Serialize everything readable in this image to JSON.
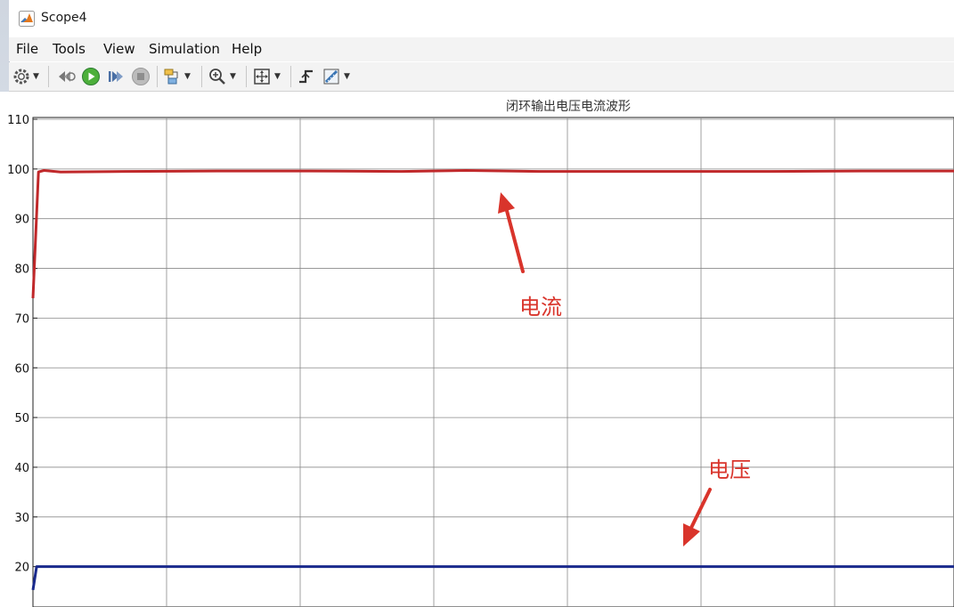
{
  "window": {
    "title": "Scope4",
    "icon": "matlab-logo-icon"
  },
  "menu": [
    "File",
    "Tools",
    "View",
    "Simulation",
    "Help"
  ],
  "toolbar": [
    {
      "name": "settings-button",
      "icon": "gear-icon",
      "dropdown": true
    },
    {
      "name": "step-back-button",
      "icon": "step-back-icon",
      "dropdown": false
    },
    {
      "name": "run-button",
      "icon": "play-icon",
      "dropdown": false
    },
    {
      "name": "step-forward-button",
      "icon": "step-forward-icon",
      "dropdown": false
    },
    {
      "name": "stop-button",
      "icon": "stop-icon",
      "dropdown": false
    },
    {
      "name": "highlight-block-button",
      "icon": "highlight-icon",
      "dropdown": true
    },
    {
      "name": "zoom-button",
      "icon": "zoom-in-icon",
      "dropdown": true
    },
    {
      "name": "autoscale-button",
      "icon": "autoscale-icon",
      "dropdown": true
    },
    {
      "name": "triggers-button",
      "icon": "trigger-icon",
      "dropdown": false
    },
    {
      "name": "cursor-measurements-button",
      "icon": "measure-icon",
      "dropdown": true
    }
  ],
  "chart_data": {
    "type": "line",
    "title": "闭环输出电压电流波形",
    "xlabel": "",
    "ylabel": "",
    "ylim": [
      15,
      110
    ],
    "yticks": [
      20,
      30,
      40,
      50,
      60,
      70,
      80,
      90,
      100,
      110
    ],
    "grid": true,
    "series": [
      {
        "color": "#c0282a",
        "x": [
          0,
          0.006,
          0.012,
          0.03,
          0.1,
          0.2,
          0.3,
          0.4,
          0.47,
          0.55,
          0.6,
          0.7,
          0.8,
          0.9,
          1.0
        ],
        "y": [
          74,
          99.4,
          99.7,
          99.4,
          99.5,
          99.6,
          99.6,
          99.5,
          99.7,
          99.5,
          99.5,
          99.5,
          99.5,
          99.6,
          99.6
        ]
      },
      {
        "color": "#1a2a8c",
        "x": [
          0,
          0.004,
          0.01,
          0.1,
          0.2,
          0.3,
          0.4,
          0.5,
          0.6,
          0.7,
          0.8,
          0.9,
          1.0
        ],
        "y": [
          15.3,
          20.0,
          20.0,
          20.0,
          20.0,
          20.0,
          20.0,
          20.0,
          20.0,
          20.0,
          20.0,
          20.0,
          20.0
        ]
      }
    ],
    "annotations": [
      {
        "text": "电流",
        "color": "#d9342b",
        "arrow": "up",
        "target_series": 0
      },
      {
        "text": "电压",
        "color": "#d9342b",
        "arrow": "down",
        "target_series": 1
      }
    ]
  }
}
